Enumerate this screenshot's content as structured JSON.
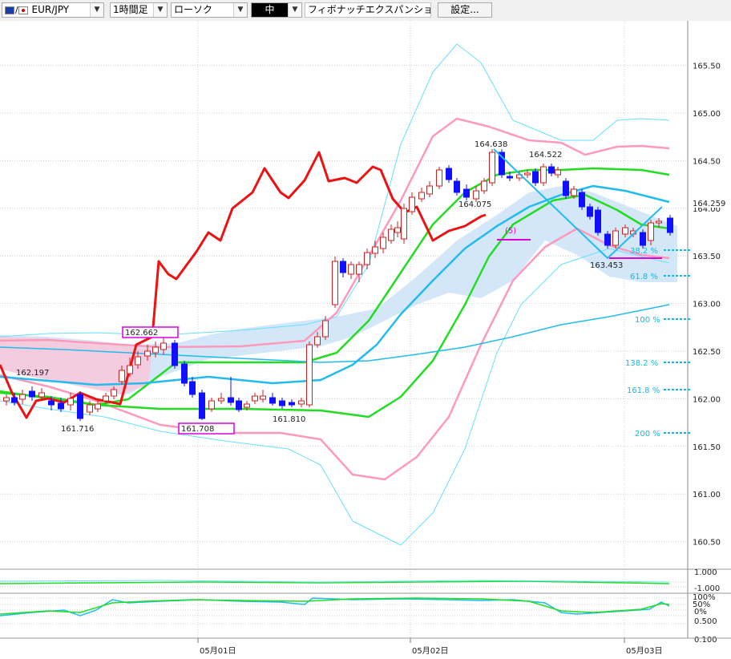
{
  "toolbar": {
    "symbol": "EUR/JPY",
    "timeframe": "1時間足",
    "chart_style": "ローソク",
    "line_width": "中",
    "indicator": "フィボナッチエクスパンション",
    "settings_label": "設定..."
  },
  "colors": {
    "up_candle": "#d02020",
    "down_candle": "#1010ff",
    "bollinger_inner": "#ff99bb",
    "bollinger_outer": "#66e0ff",
    "ma_green": "#22dd22",
    "ma_blue": "#22bbee",
    "red_line": "#ee1111",
    "fibo_label": "#11bbdd",
    "highlight_box": "#dd00dd",
    "cloud": "#cfe4f8"
  },
  "chart_data": {
    "type": "candlestick",
    "symbol": "EUR/JPY",
    "timeframe": "1時間足",
    "ylim": [
      160.3,
      166.2
    ],
    "y_ticks": [
      "160.50",
      "161.00",
      "161.50",
      "162.00",
      "162.50",
      "163.00",
      "163.50",
      "164.00",
      "164.50",
      "165.00",
      "165.50"
    ],
    "current_price": "164.259",
    "x_labels": [
      "05月01日",
      "05月02日",
      "05月03日"
    ],
    "price_annotations": [
      "162.197",
      "161.716",
      "162.662",
      "161.708",
      "161.810",
      "164.638",
      "164.522",
      "164.075",
      "163.453"
    ],
    "fibonacci_expansion": {
      "wave_label": "(5)",
      "levels": [
        "38.2 %",
        "61.8 %",
        "100 %",
        "138.2 %",
        "161.8 %",
        "200 %"
      ],
      "level_prices": [
        163.55,
        163.28,
        162.8,
        162.31,
        162.05,
        161.54
      ]
    },
    "sub_panel_1": {
      "y_ticks": [
        "1.000",
        "-1.000"
      ]
    },
    "sub_panel_2": {
      "y_ticks": [
        "100%",
        "50%",
        "0%",
        "0.500",
        "0.100"
      ]
    }
  }
}
